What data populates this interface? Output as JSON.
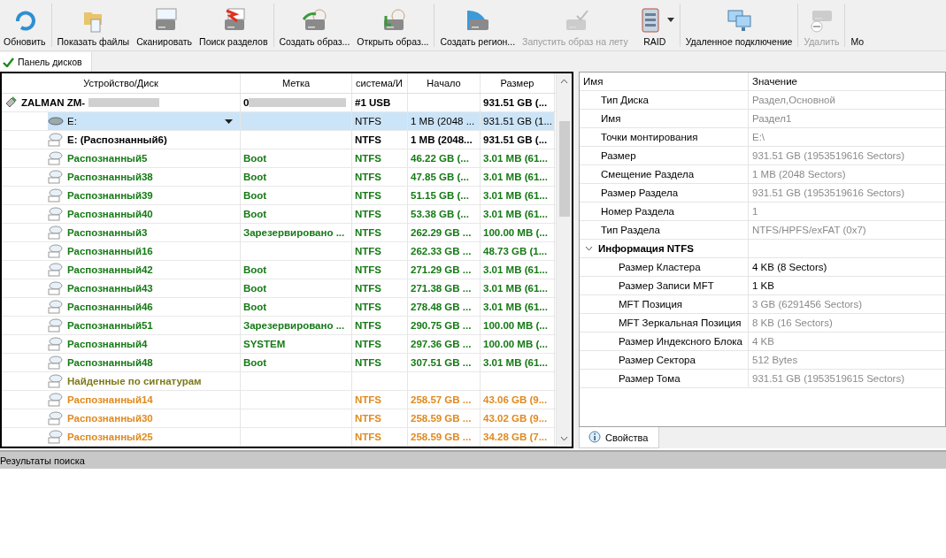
{
  "toolbar": [
    {
      "label": "Обновить",
      "disabled": false
    },
    {
      "label": "Показать файлы",
      "disabled": false
    },
    {
      "label": "Сканировать",
      "disabled": false
    },
    {
      "label": "Поиск разделов",
      "disabled": false
    },
    {
      "label": "Создать образ...",
      "disabled": false
    },
    {
      "label": "Открыть образ...",
      "disabled": false
    },
    {
      "label": "Создать регион...",
      "disabled": false
    },
    {
      "label": "Запустить образ на лету",
      "disabled": true
    },
    {
      "label": "RAID",
      "disabled": false,
      "dropdown": true
    },
    {
      "label": "Удаленное подключение",
      "disabled": false
    },
    {
      "label": "Удалить",
      "disabled": true
    },
    {
      "label": "Мо",
      "disabled": false
    }
  ],
  "panel_tab": {
    "label": "Панель дисков",
    "checked": true
  },
  "disk_table": {
    "columns": [
      "Устройство/Диск",
      "Метка",
      "система/И",
      "Начало",
      "Размер"
    ],
    "rows": [
      {
        "kind": "device",
        "selected": false,
        "name": "ZALMAN ZM-",
        "label": "0",
        "fs": "#1 USB",
        "start": "",
        "size": "931.51 GB (..."
      },
      {
        "kind": "volume",
        "selected": true,
        "name": "E:",
        "label": "",
        "fs": "NTFS",
        "start": "1 MB (2048 ...",
        "size": "931.51 GB (1..."
      },
      {
        "kind": "bold",
        "selected": false,
        "name": "E: (Распознанный6)",
        "label": "",
        "fs": "NTFS",
        "start": "1 MB (2048...",
        "size": "931.51 GB (..."
      },
      {
        "kind": "found",
        "selected": false,
        "name": "Распознанный5",
        "label": "Boot",
        "fs": "NTFS",
        "start": "46.22 GB (...",
        "size": "3.01 MB (61..."
      },
      {
        "kind": "found",
        "selected": false,
        "name": "Распознанный38",
        "label": "Boot",
        "fs": "NTFS",
        "start": "47.85 GB (...",
        "size": "3.01 MB (61..."
      },
      {
        "kind": "found",
        "selected": false,
        "name": "Распознанный39",
        "label": "Boot",
        "fs": "NTFS",
        "start": "51.15 GB (...",
        "size": "3.01 MB (61..."
      },
      {
        "kind": "found",
        "selected": false,
        "name": "Распознанный40",
        "label": "Boot",
        "fs": "NTFS",
        "start": "53.38 GB (...",
        "size": "3.01 MB (61..."
      },
      {
        "kind": "found",
        "selected": false,
        "name": "Распознанный3",
        "label": "Зарезервировано ...",
        "fs": "NTFS",
        "start": "262.29 GB ...",
        "size": "100.00 MB (..."
      },
      {
        "kind": "found",
        "selected": false,
        "name": "Распознанный16",
        "label": "",
        "fs": "NTFS",
        "start": "262.33 GB ...",
        "size": "48.73 GB (1..."
      },
      {
        "kind": "found",
        "selected": false,
        "name": "Распознанный42",
        "label": "Boot",
        "fs": "NTFS",
        "start": "271.29 GB ...",
        "size": "3.01 MB (61..."
      },
      {
        "kind": "found",
        "selected": false,
        "name": "Распознанный43",
        "label": "Boot",
        "fs": "NTFS",
        "start": "271.38 GB ...",
        "size": "3.01 MB (61..."
      },
      {
        "kind": "found",
        "selected": false,
        "name": "Распознанный46",
        "label": "Boot",
        "fs": "NTFS",
        "start": "278.48 GB ...",
        "size": "3.01 MB (61..."
      },
      {
        "kind": "found",
        "selected": false,
        "name": "Распознанный51",
        "label": "Зарезервировано ...",
        "fs": "NTFS",
        "start": "290.75 GB ...",
        "size": "100.00 MB (..."
      },
      {
        "kind": "found",
        "selected": false,
        "name": "Распознанный4",
        "label": "SYSTEM",
        "fs": "NTFS",
        "start": "297.36 GB ...",
        "size": "100.00 MB (..."
      },
      {
        "kind": "found",
        "selected": false,
        "name": "Распознанный48",
        "label": "Boot",
        "fs": "NTFS",
        "start": "307.51 GB ...",
        "size": "3.01 MB (61..."
      },
      {
        "kind": "signature",
        "selected": false,
        "name": "Найденные по сигнатурам",
        "label": "",
        "fs": "",
        "start": "",
        "size": ""
      },
      {
        "kind": "raw",
        "selected": false,
        "name": "Распознанный14",
        "label": "",
        "fs": "NTFS",
        "start": "258.57 GB ...",
        "size": "43.06 GB (9..."
      },
      {
        "kind": "raw",
        "selected": false,
        "name": "Распознанный30",
        "label": "",
        "fs": "NTFS",
        "start": "258.59 GB ...",
        "size": "43.02 GB (9..."
      },
      {
        "kind": "raw",
        "selected": false,
        "name": "Распознанный25",
        "label": "",
        "fs": "NTFS",
        "start": "258.59 GB ...",
        "size": "34.28 GB (7..."
      }
    ]
  },
  "properties": {
    "columns": [
      "Имя",
      "Значение"
    ],
    "items": [
      {
        "name": "Тип Диска",
        "value": "Раздел,Основной",
        "dim": true
      },
      {
        "name": "Имя",
        "value": "Раздел1",
        "dim": true
      },
      {
        "name": "Точки монтирования",
        "value": "E:\\",
        "dim": true
      },
      {
        "name": "Размер",
        "value": "931.51 GB (1953519616 Sectors)",
        "dim": true
      },
      {
        "name": "Смещение Раздела",
        "value": "1 MB (2048 Sectors)",
        "dim": true
      },
      {
        "name": "Размер Раздела",
        "value": "931.51 GB (1953519616 Sectors)",
        "dim": true
      },
      {
        "name": "Номер Раздела",
        "value": "1",
        "dim": true
      },
      {
        "name": "Тип Раздела",
        "value": "NTFS/HPFS/exFAT (0x7)",
        "dim": true
      },
      {
        "name": "Информация NTFS",
        "value": "",
        "dim": false,
        "expanded": true,
        "children": [
          {
            "name": "Размер Кластера",
            "value": "4 KB (8 Sectors)",
            "dim": false
          },
          {
            "name": "Размер Записи MFT",
            "value": "1 KB",
            "dim": false
          },
          {
            "name": "MFT Позиция",
            "value": "3 GB (6291456 Sectors)",
            "dim": true
          },
          {
            "name": "MFT Зеркальная Позиция",
            "value": "8 KB (16 Sectors)",
            "dim": true
          },
          {
            "name": "Размер Индексного Блока",
            "value": "4 KB",
            "dim": true
          },
          {
            "name": "Размер Сектора",
            "value": "512 Bytes",
            "dim": true
          },
          {
            "name": "Размер Тома",
            "value": "931.51 GB (1953519615 Sectors)",
            "dim": true
          }
        ]
      }
    ],
    "tab": {
      "label": "Свойства",
      "selected": true
    }
  },
  "status_bar": {
    "label": "Результаты поиска"
  }
}
